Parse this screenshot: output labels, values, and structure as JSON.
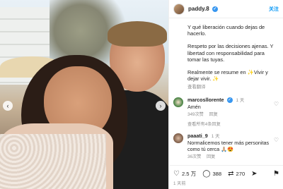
{
  "post": {
    "username": "paddy.8",
    "follow_label": "关注",
    "caption_paragraphs": [
      "Y qué liberación cuando dejas de hacerlo.",
      "Respeto por las decisiones ajenas. Y libertad con responsabilidad para tomar las tuyas.",
      "Realmente se resume en ✨Vivir y dejar vivir. ✨"
    ],
    "see_translation": "查看翻译"
  },
  "comments": [
    {
      "user": "marcosllorente",
      "time": "1 天",
      "text": "Amén",
      "likes": "349次赞",
      "reply": "回复",
      "view_replies": "查看所有4条回复"
    },
    {
      "user": "paaati_9",
      "time": "1 天",
      "text": "Normalicemos tener más personitas como tú cerca 🙏🏼😍",
      "likes": "36次赞",
      "reply": "回复"
    }
  ],
  "actions": {
    "likes": "2.5 万",
    "comments": "388",
    "shares": "270"
  },
  "date": "1 天前"
}
